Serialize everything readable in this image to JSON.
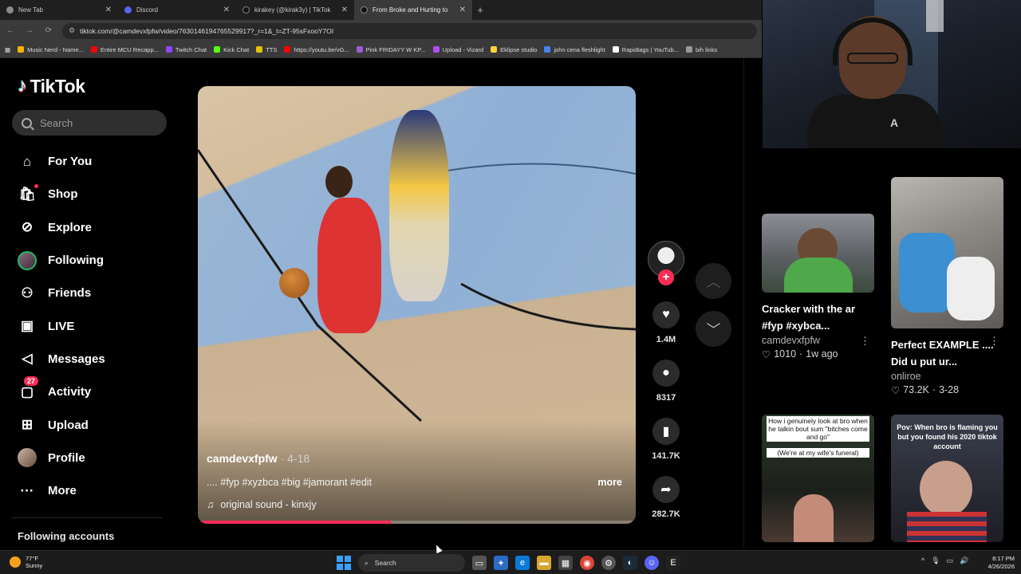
{
  "browser": {
    "tabs": [
      {
        "title": "New Tab",
        "active": false
      },
      {
        "title": "Discord",
        "active": false
      },
      {
        "title": "kirakey (@kirak3y) | TikTok",
        "active": false
      },
      {
        "title": "From Broke and Hurting to",
        "active": true
      }
    ],
    "url": "tiktok.com/@camdevxfpfw/video/7630146194765529917?_r=1&_t=ZT-95sFxooY7OI",
    "bookmarks": [
      "Music Nerd - Name...",
      "Entire MCU Recapp...",
      "Twitch Chat",
      "Kick Chat",
      "TTS",
      "https://youtu.be/vG...",
      "Pink FRIDAYY W KP...",
      "Upload - Vizard",
      "Eklipse studio",
      "john cena fleshlight",
      "Rapidtags | YouTub...",
      "bih links"
    ]
  },
  "tiktok": {
    "logo_text": "TikTok",
    "search_placeholder": "Search",
    "nav": [
      {
        "label": "For You",
        "icon": "home-icon"
      },
      {
        "label": "Shop",
        "icon": "shopping-bag-icon"
      },
      {
        "label": "Explore",
        "icon": "compass-icon"
      },
      {
        "label": "Following",
        "icon": "following-avatar-icon"
      },
      {
        "label": "Friends",
        "icon": "friends-icon"
      },
      {
        "label": "LIVE",
        "icon": "live-icon"
      },
      {
        "label": "Messages",
        "icon": "messages-icon"
      },
      {
        "label": "Activity",
        "icon": "activity-icon",
        "badge": "27"
      },
      {
        "label": "Upload",
        "icon": "upload-icon"
      },
      {
        "label": "Profile",
        "icon": "profile-avatar-icon"
      },
      {
        "label": "More",
        "icon": "more-icon"
      }
    ],
    "following_accounts_label": "Following accounts",
    "video": {
      "author": "camdevxfpfw",
      "date": " · 4-18",
      "caption": ".... #fyp #xyzbca #big #jamorant #edit",
      "more_label": "more",
      "sound": "original sound - kinxjy",
      "progress": 0.44
    },
    "actions": {
      "likes": "1.4M",
      "comments": "8317",
      "saves": "141.7K",
      "shares": "282.7K"
    },
    "recommendations": [
      {
        "title": "Cracker with the ar #fyp #xybca...",
        "author": "camdevxfpfw",
        "likes": "1010",
        "age": "1w ago"
      },
      {
        "title": "Perfect EXAMPLE .... Did u put ur...",
        "author": "onliroe",
        "likes": "73.2K",
        "age": "3-28"
      },
      {
        "overlay_top": "How i genuinely look at bro when he talkin bout sum \"bitches come and go\"",
        "overlay_bottom": "(We're at my wife's funeral)"
      },
      {
        "overlay_top": "Pov: When bro is flaming you but you found his 2020 tiktok account"
      }
    ]
  },
  "taskbar": {
    "temp": "77°F",
    "condition": "Sunny",
    "search_label": "Search",
    "time": "8:17 PM",
    "date": "4/26/2026"
  },
  "colors": {
    "accent": "#fe2c55",
    "progress": "#fe2c55"
  }
}
